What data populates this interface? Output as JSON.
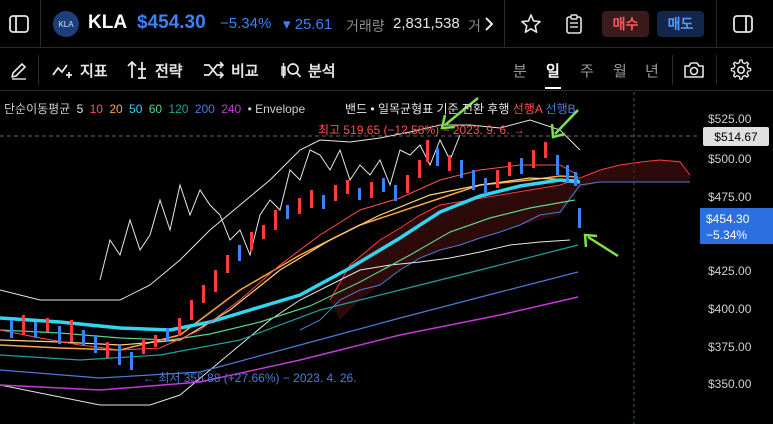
{
  "header": {
    "logo_text": "KLA",
    "ticker": "KLA",
    "price": "$454.30",
    "change_pct": "−5.34%",
    "change_abs": "▾ 25.61",
    "volume_label": "거래량",
    "volume_value": "2,831,538",
    "volume_more": "거",
    "buy_label": "매수",
    "sell_label": "매도",
    "icons": [
      "sidebar-toggle-icon",
      "chevron-right-icon",
      "star-icon",
      "clipboard-icon",
      "panel-icon"
    ]
  },
  "toolbar": {
    "indicator_label": "지표",
    "strategy_label": "전략",
    "compare_label": "비교",
    "analysis_label": "분석",
    "timeframes": [
      "분",
      "일",
      "주",
      "월",
      "년"
    ],
    "active_timeframe": "일"
  },
  "legend": {
    "ma_title": "단순이동평균",
    "ma_periods": [
      "5",
      "10",
      "20",
      "50",
      "60",
      "120",
      "200",
      "240"
    ],
    "envelope": "• Envelope",
    "band_text": "밴드 • 일목균형표 기준 전환 후행",
    "span_a": "선행A",
    "span_b": "선행B"
  },
  "annotations": {
    "high": "최고 519.65 (−12.58%) − 2023. 9. 6. →",
    "low": "← 최저 355.88 (+27.66%) − 2023. 4. 26."
  },
  "price_axis": {
    "ticks": [
      "$525.00",
      "$500.00",
      "$475.00",
      "$425.00",
      "$400.00",
      "$375.00",
      "$350.00"
    ],
    "high_tag": "$514.67",
    "current_price": "$454.30",
    "current_change": "−5.34%"
  },
  "colors": {
    "up": "#ff3b3b",
    "down": "#3b82f6",
    "accent": "#2b6fe0",
    "arrow": "#7ee04a"
  }
}
